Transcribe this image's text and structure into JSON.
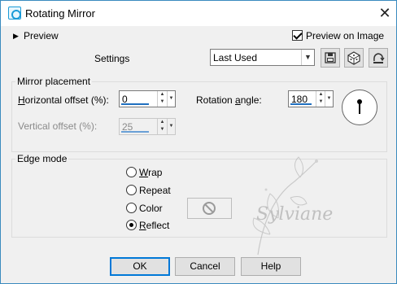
{
  "window": {
    "title": "Rotating Mirror",
    "close_glyph": "✕",
    "icons": {
      "app": "rotating-mirror-app-icon",
      "close": "close-icon"
    }
  },
  "top": {
    "preview_toggle_glyph": "▶",
    "preview_label": "Preview",
    "preview_on_image_label": "Preview on Image",
    "preview_on_image_checked": true,
    "settings_label": "Settings",
    "settings_value": "Last Used",
    "toolbar_icons": [
      "save-preset-icon",
      "randomize-dice-icon",
      "reset-icon"
    ]
  },
  "mirror_placement": {
    "title": "Mirror placement",
    "horizontal_offset": {
      "label_mnemonic": "H",
      "label_rest": "orizontal offset (%):",
      "value": "0",
      "enabled": true
    },
    "vertical_offset": {
      "label": "Vertical offset (%):",
      "value": "25",
      "enabled": false
    },
    "rotation_angle": {
      "label_prefix": "Rotation ",
      "label_mnemonic": "a",
      "label_suffix": "ngle:",
      "value": "180"
    },
    "dial_icon": "angle-dial-icon"
  },
  "edge_mode": {
    "title": "Edge mode",
    "options": [
      {
        "mnemonic": "W",
        "rest": "rap",
        "selected": false
      },
      {
        "mnemonic": "",
        "rest": "Repeat",
        "selected": false,
        "underline_index": 5
      },
      {
        "mnemonic": "",
        "rest": "Color",
        "selected": false
      },
      {
        "mnemonic": "R",
        "rest": "eflect",
        "selected": true
      }
    ],
    "repeat_full": "Repeat",
    "color_full": "Color",
    "color_swatch_icon": "no-color-icon"
  },
  "watermark_text": "Sylviane",
  "buttons": {
    "ok": "OK",
    "cancel": "Cancel",
    "help": "Help"
  }
}
